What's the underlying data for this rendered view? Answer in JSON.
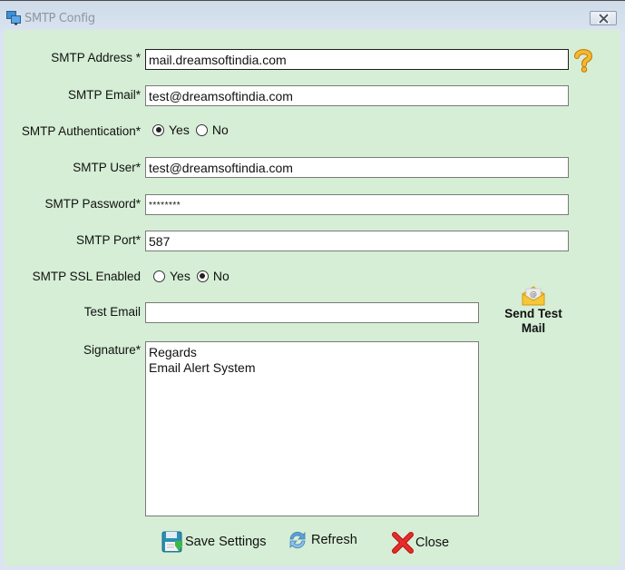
{
  "window": {
    "title": "SMTP Config",
    "app_icon": "monitors-icon",
    "close_icon": "close-icon"
  },
  "form": {
    "smtp_address": {
      "label": "SMTP Address *",
      "value": "mail.dreamsoftindia.com"
    },
    "smtp_email": {
      "label": "SMTP Email*",
      "value": "test@dreamsoftindia.com"
    },
    "smtp_authentication": {
      "label": "SMTP Authentication*",
      "options": [
        "Yes",
        "No"
      ],
      "selected": "Yes"
    },
    "smtp_user": {
      "label": "SMTP User*",
      "value": "test@dreamsoftindia.com"
    },
    "smtp_password": {
      "label": "SMTP Password*",
      "value": "********"
    },
    "smtp_port": {
      "label": "SMTP Port*",
      "value": "587"
    },
    "smtp_ssl": {
      "label": "SMTP SSL Enabled",
      "options": [
        "Yes",
        "No"
      ],
      "selected": "No"
    },
    "test_email": {
      "label": "Test Email",
      "value": ""
    },
    "signature": {
      "label": "Signature*",
      "value": "Regards\nEmail Alert System"
    }
  },
  "help_icon": "question-mark-icon",
  "send_test_mail": {
    "label": "Send Test Mail",
    "icon": "envelope-icon"
  },
  "buttons": {
    "save": {
      "label": "Save Settings",
      "icon": "floppy-disk-icon"
    },
    "refresh": {
      "label": "Refresh",
      "icon": "refresh-icon"
    },
    "close": {
      "label": "Close",
      "icon": "red-x-icon"
    }
  }
}
